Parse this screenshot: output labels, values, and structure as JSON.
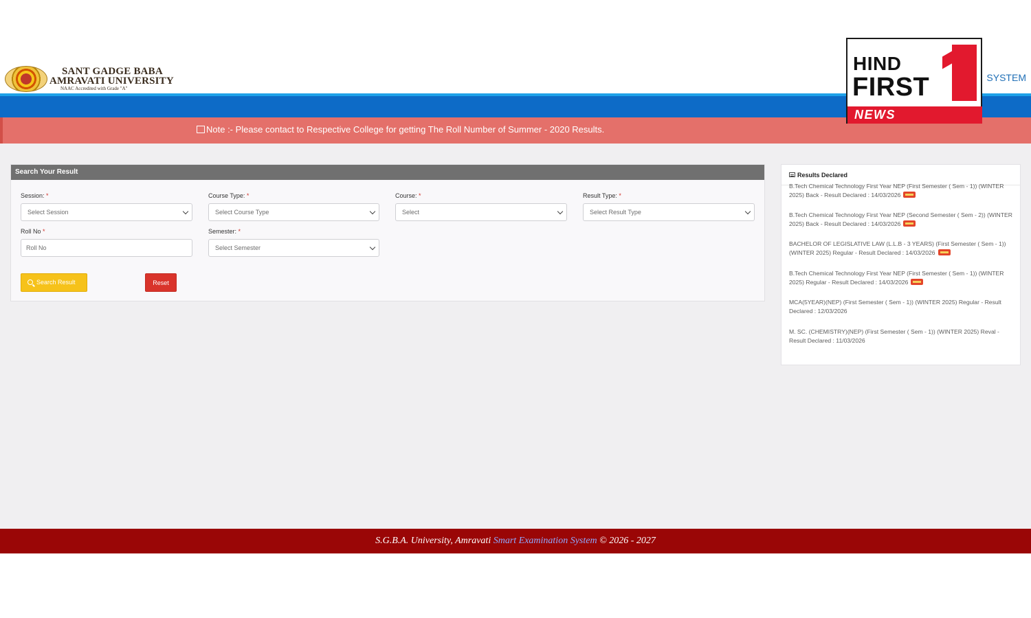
{
  "header": {
    "logo_line1": "SANT GADGE BABA",
    "logo_line2": "AMRAVATI UNIVERSITY",
    "logo_line3": "NAAC Accredited with Grade \"A\"",
    "system_title": "SYSTEM"
  },
  "note": {
    "text": "Note :- Please contact to Respective College for getting The Roll Number of Summer - 2020 Results."
  },
  "search_form": {
    "title": "Search Your Result",
    "session": {
      "label": "Session:",
      "value": "Select Session"
    },
    "course_type": {
      "label": "Course Type:",
      "value": "Select Course Type"
    },
    "course": {
      "label": "Course:",
      "value": "Select"
    },
    "result_type": {
      "label": "Result Type:",
      "value": "Select Result Type"
    },
    "roll_no": {
      "label": "Roll No",
      "placeholder": "Roll No"
    },
    "semester": {
      "label": "Semester:",
      "value": "Select Semester"
    },
    "required_mark": "*",
    "search_button": "Search Result",
    "reset_button": "Reset"
  },
  "results_declared": {
    "title": "Results Declared",
    "items": [
      {
        "text": "B.Tech Chemical Technology First Year NEP (First Semester ( Sem - 1)) (WINTER 2025) Back - Result Declared : 14/03/2026",
        "is_new": true
      },
      {
        "text": "B.Tech Chemical Technology First Year NEP (Second Semester ( Sem - 2)) (WINTER 2025) Back - Result Declared : 14/03/2026",
        "is_new": true
      },
      {
        "text": "BACHELOR OF LEGISLATIVE LAW (L.L.B - 3 YEARS) (First Semester ( Sem - 1)) (WINTER 2025) Regular - Result Declared : 14/03/2026",
        "is_new": true
      },
      {
        "text": "B.Tech Chemical Technology First Year NEP (First Semester ( Sem - 1)) (WINTER 2025) Regular - Result Declared : 14/03/2026",
        "is_new": true
      },
      {
        "text": "MCA(5YEAR)(NEP) (First Semester ( Sem - 1)) (WINTER 2025) Regular - Result Declared : 12/03/2026",
        "is_new": false
      },
      {
        "text": "M. SC. (CHEMISTRY)(NEP) (First Semester ( Sem - 1)) (WINTER 2025) Reval - Result Declared : 11/03/2026",
        "is_new": false
      }
    ]
  },
  "footer": {
    "prefix": "S.G.B.A. University, Amravati ",
    "link": "Smart Examination System",
    "suffix": " © 2026 - 2027"
  },
  "watermark": {
    "line1": "HIND",
    "line2": "FIRST",
    "line3": "NEWS"
  },
  "colors": {
    "blue_band": "#0d6bc7",
    "note_band": "#e4706a",
    "search_button": "#f6c21a",
    "reset_button": "#d9342b",
    "footer": "#9a0606"
  }
}
